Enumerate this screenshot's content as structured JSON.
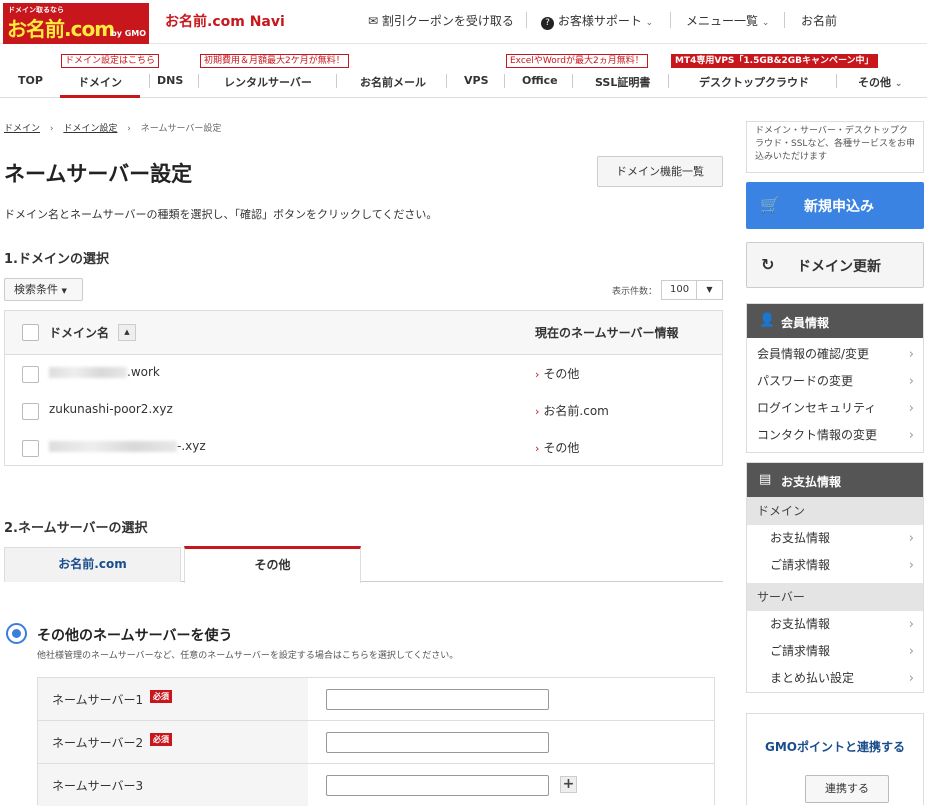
{
  "header": {
    "logo_small": "ドメイン取るなら",
    "logo_text": "お名前.com",
    "logo_gmo": "by GMO",
    "navi_title": "お名前.com Navi",
    "coupon": "割引クーポンを受け取る",
    "support": "お客様サポート",
    "menu": "メニュー一覧",
    "user": "お名前"
  },
  "gnav": {
    "items": [
      "TOP",
      "ドメイン",
      "DNS",
      "レンタルサーバー",
      "お名前メール",
      "VPS",
      "Office",
      "SSL証明書",
      "デスクトップクラウド",
      "その他"
    ],
    "badges": [
      "ドメイン設定はこちら",
      "初期費用＆月額最大2ケ月が無料！",
      "ExcelやWordが最大2ヵ月無料！",
      "MT4専用VPS「1.5GB&2GBキャンペーン中」"
    ]
  },
  "breadcrumb": {
    "items": [
      "ドメイン",
      "ドメイン設定",
      "ネームサーバー設定"
    ]
  },
  "page": {
    "title": "ネームサーバー設定",
    "domain_list_button": "ドメイン機能一覧",
    "description": "ドメイン名とネームサーバーの種類を選択し、「確認」ボタンをクリックしてください。"
  },
  "section1": {
    "title": "1.ドメインの選択",
    "search_cond": "検索条件",
    "display_label": "表示件数：",
    "display_value": "100",
    "col_domain": "ドメイン名",
    "col_ns": "現在のネームサーバー情報",
    "rows": [
      {
        "domain": ".work",
        "ns": "その他"
      },
      {
        "domain": "zukunashi-poor2.xyz",
        "ns": "お名前.com"
      },
      {
        "domain": "-.xyz",
        "ns": "その他"
      }
    ]
  },
  "section2": {
    "title": "2.ネームサーバーの選択",
    "tab_onamae": "お名前.com",
    "tab_other": "その他",
    "radio_label": "その他のネームサーバーを使う",
    "radio_desc": "他社様管理のネームサーバーなど、任意のネームサーバーを設定する場合はこちらを選択してください。",
    "required": "必須",
    "ns_labels": [
      "ネームサーバー1",
      "ネームサーバー2",
      "ネームサーバー3"
    ]
  },
  "aside": {
    "note": "ドメイン・サーバー・デスクトップクラウド・SSLなど、各種サービスをお申込みいただけます",
    "new_button": "新規申込み",
    "renew_button": "ドメイン更新",
    "member_title": "会員情報",
    "member_items": [
      "会員情報の確認/変更",
      "パスワードの変更",
      "ログインセキュリティ",
      "コンタクト情報の変更"
    ],
    "payment_title": "お支払情報",
    "cat_domain": "ドメイン",
    "domain_items": [
      "お支払情報",
      "ご請求情報"
    ],
    "cat_server": "サーバー",
    "server_items": [
      "お支払情報",
      "ご請求情報",
      "まとめ払い設定"
    ],
    "gmo_link": "GMOポイントと連携する",
    "gmo_button": "連携する"
  },
  "colors": {
    "brand_red": "#c8161d",
    "button_blue": "#3b83e3",
    "link_navy": "#1a4d8c"
  }
}
